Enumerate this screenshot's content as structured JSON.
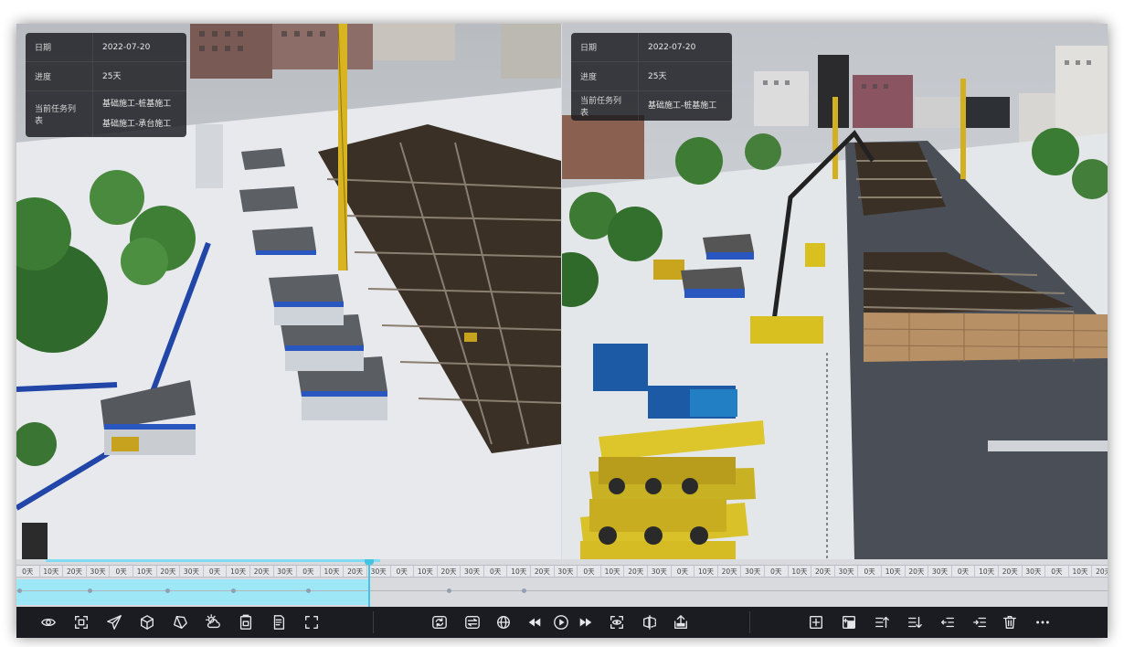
{
  "left_panel": {
    "date_label": "日期",
    "date_value": "2022-07-20",
    "progress_label": "进度",
    "progress_value": "25天",
    "tasks_label": "当前任务列表",
    "tasks": [
      "基础施工-桩基施工",
      "基础施工-承台施工"
    ]
  },
  "right_panel": {
    "date_label": "日期",
    "date_value": "2022-07-20",
    "progress_label": "进度",
    "progress_value": "25天",
    "tasks_label": "当前任务列表",
    "tasks": [
      "基础施工-桩基施工"
    ]
  },
  "timeline": {
    "tick_labels": [
      "0天",
      "10天",
      "20天",
      "30天"
    ],
    "progress_fraction": 0.323
  },
  "toolbar": {
    "left_tools": [
      "eye-icon",
      "focus-frame-icon",
      "send-icon",
      "cube-icon",
      "polygon-icon",
      "weather-icon",
      "schedule-icon",
      "document-icon",
      "fullscreen-icon"
    ],
    "center_tools": [
      "sync-icon",
      "sync-alt-icon",
      "globe-icon",
      "rewind-icon",
      "play-icon",
      "fast-forward-icon",
      "view-capture-icon",
      "split-view-icon",
      "export-icon"
    ],
    "right_tools": [
      "add-icon",
      "add-group-icon",
      "move-up-icon",
      "move-down-icon",
      "outdent-icon",
      "indent-icon",
      "delete-icon",
      "more-icon"
    ]
  },
  "colors": {
    "timeline_fill": "#9ee7f7",
    "playhead": "#45c3e3",
    "toolbar_bg": "#1a1c21"
  }
}
